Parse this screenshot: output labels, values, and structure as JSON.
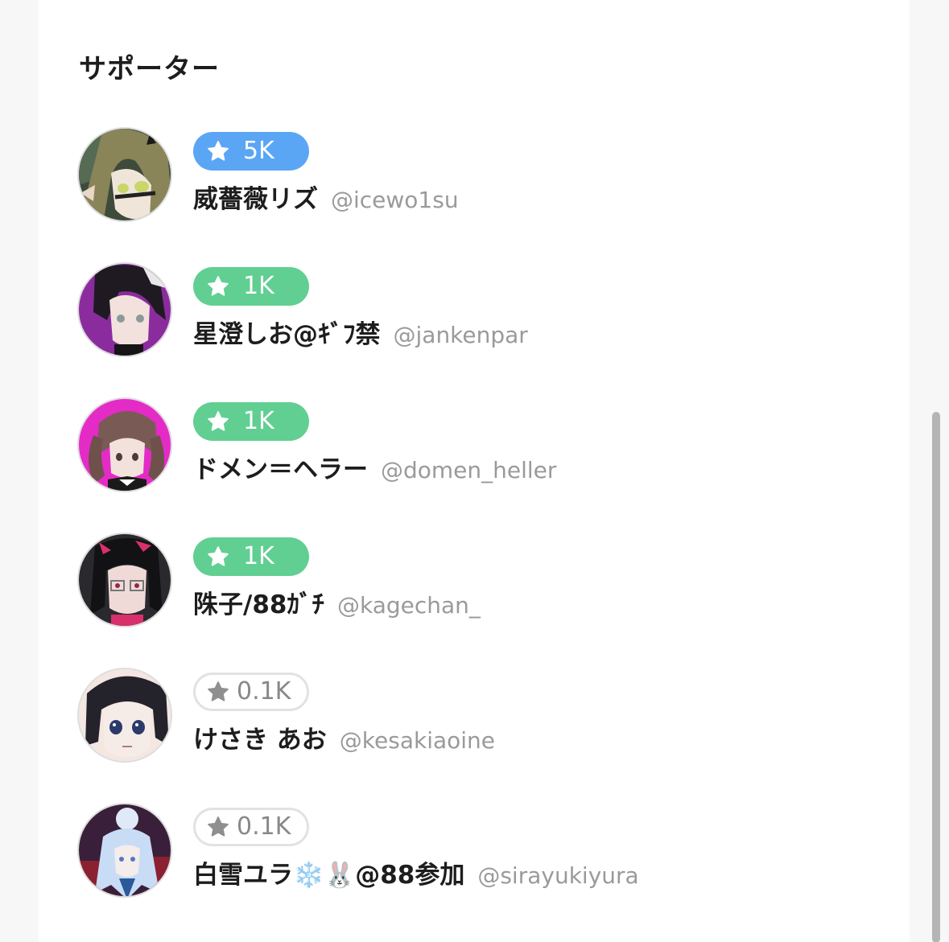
{
  "section": {
    "title": "サポーター"
  },
  "supporters": [
    {
      "amount": "5K",
      "tier": "blue",
      "name": "威薔薇リズ",
      "handle": "@icewo1su",
      "avatar_icon": "avatar-olive-hair-elf",
      "avatar_colors": [
        "#7f7b58",
        "#e8e2d2"
      ]
    },
    {
      "amount": "1K",
      "tier": "green",
      "name": "星澄しお@ｷﾞﾌ禁",
      "handle": "@jankenpar",
      "avatar_icon": "avatar-dark-hair-purple",
      "avatar_colors": [
        "#8b2c9e",
        "#1f1a22"
      ]
    },
    {
      "amount": "1K",
      "tier": "green",
      "name": "ドメン＝ヘラー",
      "handle": "@domen_heller",
      "avatar_icon": "avatar-twin-tails-pink",
      "avatar_colors": [
        "#e42bc6",
        "#7a5a55"
      ]
    },
    {
      "amount": "1K",
      "tier": "green",
      "name": "陎子/88ｶﾞﾁ",
      "handle": "@kagechan_",
      "avatar_icon": "avatar-glasses-black-hair",
      "avatar_colors": [
        "#2a2a2e",
        "#f0dad8"
      ]
    },
    {
      "amount": "0.1K",
      "tier": "grey",
      "name": "けさき あお",
      "handle": "@kesakiaoine",
      "avatar_icon": "avatar-black-hair-blue-eyes",
      "avatar_colors": [
        "#24232b",
        "#f4e6e0"
      ]
    },
    {
      "amount": "0.1K",
      "tier": "grey",
      "name": "白雪ユラ❄️🐰@88参加",
      "handle": "@sirayukiyura",
      "avatar_icon": "avatar-white-hair-night",
      "avatar_colors": [
        "#3a1f3a",
        "#c9dcf5"
      ]
    }
  ],
  "theme": {
    "tier_blue": "#5aa6f5",
    "tier_green": "#61cf92",
    "tier_grey_border": "#e2e2e2",
    "handle_color": "#9a9a9a"
  }
}
